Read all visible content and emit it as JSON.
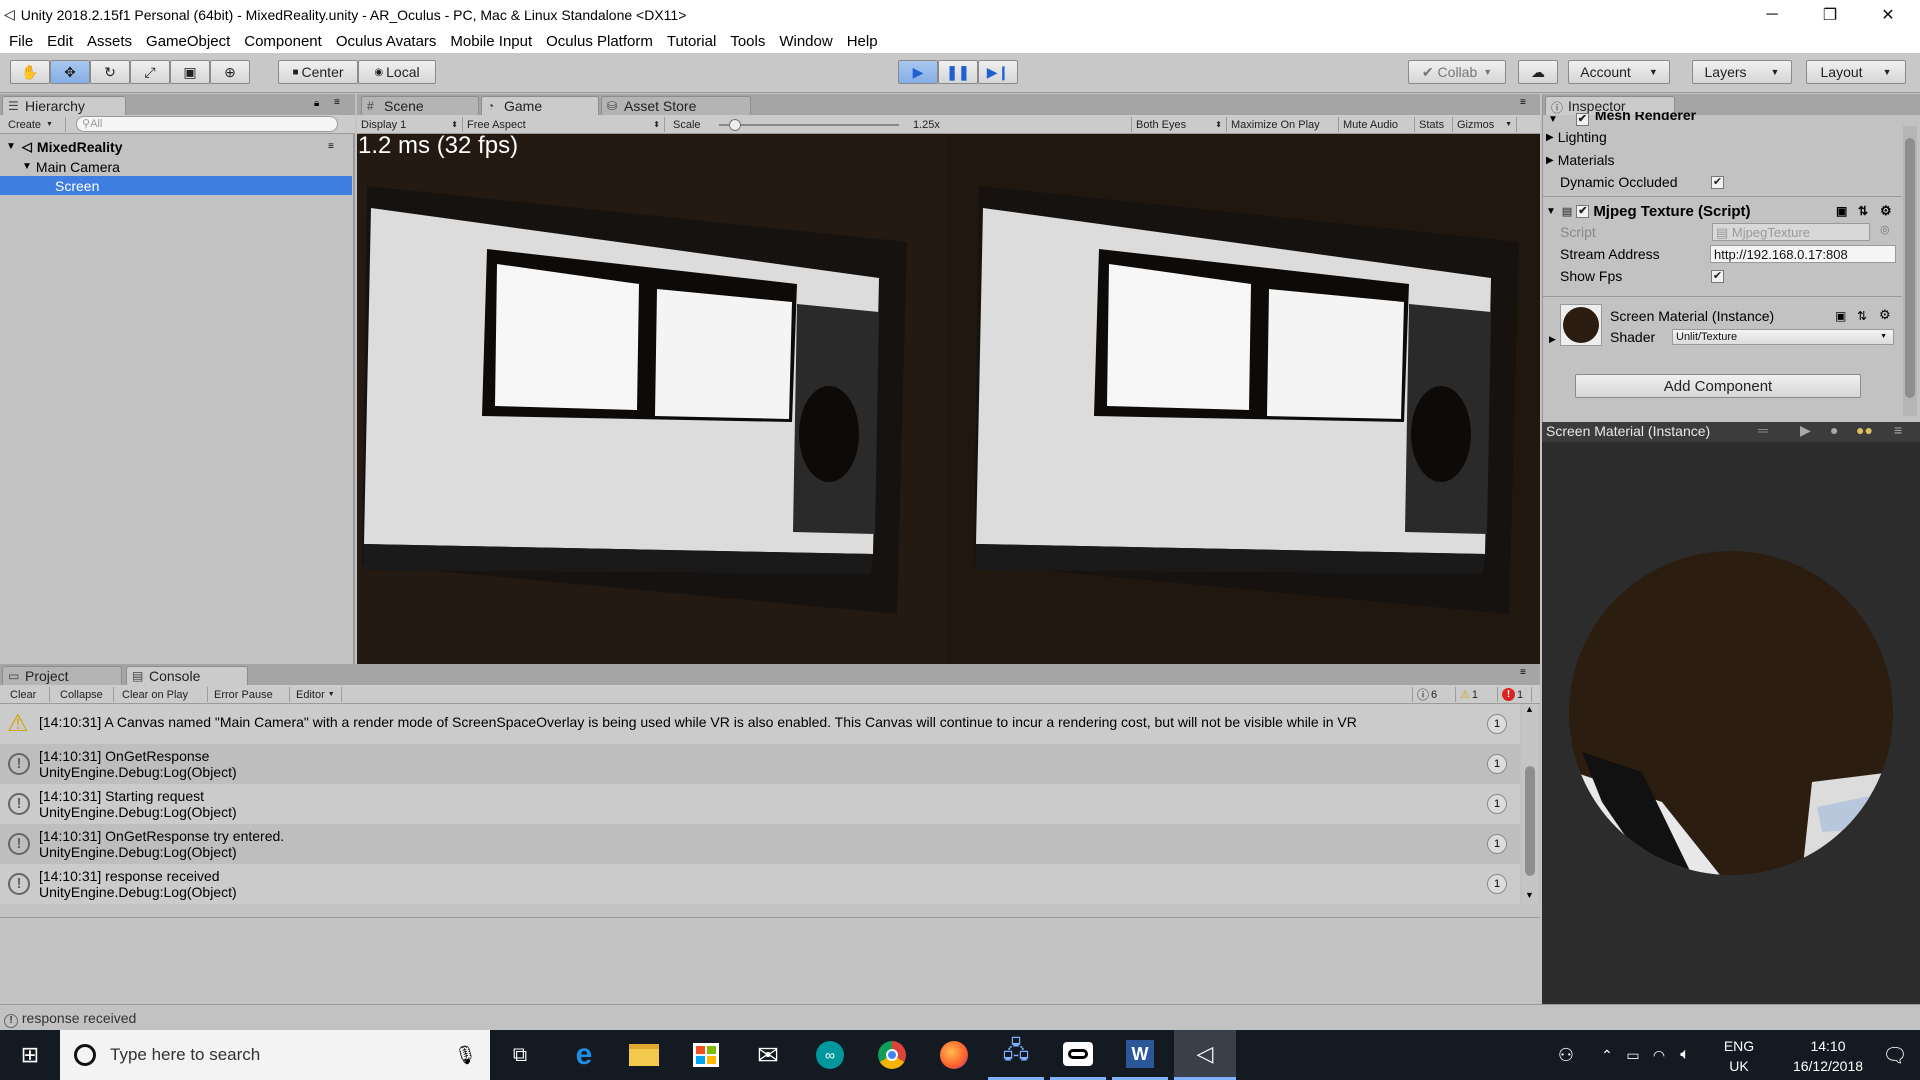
{
  "window": {
    "title": "Unity 2018.2.15f1 Personal (64bit) - MixedReality.unity - AR_Oculus - PC, Mac & Linux Standalone <DX11>",
    "minimize": "─",
    "maximize": "❐",
    "close": "✕"
  },
  "menu": [
    "File",
    "Edit",
    "Assets",
    "GameObject",
    "Component",
    "Oculus Avatars",
    "Mobile Input",
    "Oculus Platform",
    "Tutorial",
    "Tools",
    "Window",
    "Help"
  ],
  "toolbar": {
    "center_label": "Center",
    "local_label": "Local",
    "collab_label": "Collab",
    "account_label": "Account",
    "layers_label": "Layers",
    "layout_label": "Layout"
  },
  "hierarchy": {
    "tab": "Hierarchy",
    "create_label": "Create",
    "search_placeholder": "All",
    "scene": "MixedReality",
    "items": [
      "Main Camera",
      "Screen"
    ]
  },
  "view_tabs": {
    "scene": "Scene",
    "game": "Game",
    "asset_store": "Asset Store"
  },
  "game_toolbar": {
    "display": "Display 1",
    "aspect": "Free Aspect",
    "scale_label": "Scale",
    "scale_value": "1.25x",
    "both_eyes": "Both Eyes",
    "maximize": "Maximize On Play",
    "mute": "Mute Audio",
    "stats": "Stats",
    "gizmos": "Gizmos"
  },
  "game_view": {
    "fps_text": "1.2 ms (32 fps)",
    "scale_slider_fraction": 0.06
  },
  "inspector": {
    "tab": "Inspector",
    "mesh_renderer": "Mesh Renderer",
    "lighting": "Lighting",
    "materials": "Materials",
    "dynamic_occluded": "Dynamic Occluded",
    "script_component": "Mjpeg Texture (Script)",
    "script_label": "Script",
    "script_value": "MjpegTexture",
    "stream_label": "Stream Address",
    "stream_value": "http://192.168.0.17:808",
    "show_fps": "Show Fps",
    "material_name": "Screen Material (Instance)",
    "shader_label": "Shader",
    "shader_value": "Unlit/Texture",
    "add_component": "Add Component",
    "preview_title": "Screen Material (Instance)"
  },
  "bottom_tabs": {
    "project": "Project",
    "console": "Console"
  },
  "console_toolbar": {
    "clear": "Clear",
    "collapse": "Collapse",
    "clear_on_play": "Clear on Play",
    "error_pause": "Error Pause",
    "editor": "Editor",
    "log_count": "6",
    "warn_count": "1",
    "error_count": "1"
  },
  "console_rows": [
    {
      "text1": "[14:10:31] A Canvas named \"Main Camera\" with a render mode of ScreenSpaceOverlay is being used while VR is also enabled. This Canvas will continue to incur a rendering cost, but will not be visible while in VR",
      "text2": "",
      "count": "1",
      "kind": "warning"
    },
    {
      "text1": "[14:10:31] OnGetResponse",
      "text2": "UnityEngine.Debug:Log(Object)",
      "count": "1",
      "kind": "log"
    },
    {
      "text1": "[14:10:31] Starting request",
      "text2": "UnityEngine.Debug:Log(Object)",
      "count": "1",
      "kind": "log"
    },
    {
      "text1": "[14:10:31] OnGetResponse try entered.",
      "text2": "UnityEngine.Debug:Log(Object)",
      "count": "1",
      "kind": "log"
    },
    {
      "text1": "[14:10:31] response received",
      "text2": "UnityEngine.Debug:Log(Object)",
      "count": "1",
      "kind": "log"
    }
  ],
  "status_bar": "response received",
  "taskbar": {
    "search_placeholder": "Type here to search",
    "lang1": "ENG",
    "lang2": "UK",
    "time": "14:10",
    "date": "16/12/2018"
  },
  "colors": {
    "play_active": "#7fa9e8",
    "selection": "#3d7ee0",
    "taskbar": "#141a22"
  }
}
